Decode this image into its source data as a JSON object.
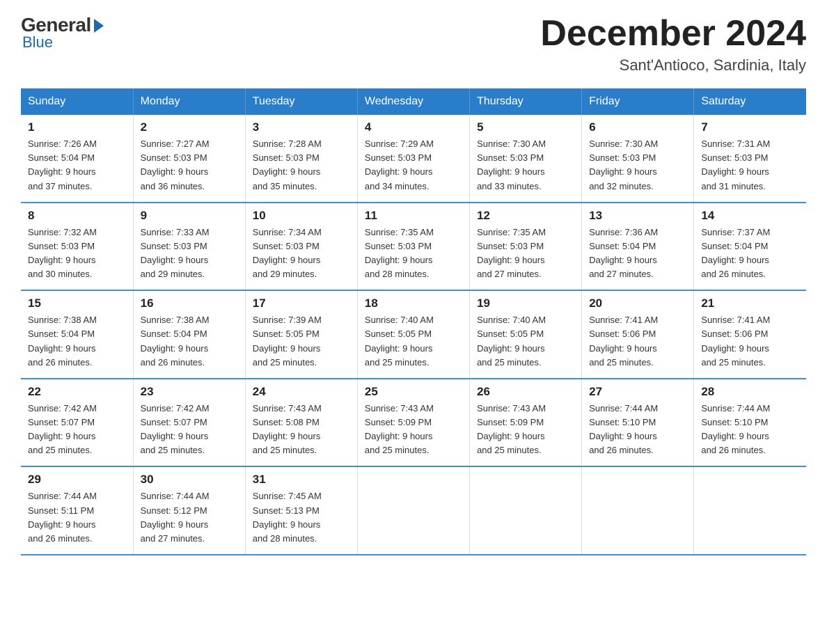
{
  "logo": {
    "general": "General",
    "blue": "Blue"
  },
  "header": {
    "month_year": "December 2024",
    "location": "Sant'Antioco, Sardinia, Italy"
  },
  "days_of_week": [
    "Sunday",
    "Monday",
    "Tuesday",
    "Wednesday",
    "Thursday",
    "Friday",
    "Saturday"
  ],
  "weeks": [
    [
      {
        "day": "1",
        "sunrise": "7:26 AM",
        "sunset": "5:04 PM",
        "daylight": "9 hours and 37 minutes."
      },
      {
        "day": "2",
        "sunrise": "7:27 AM",
        "sunset": "5:03 PM",
        "daylight": "9 hours and 36 minutes."
      },
      {
        "day": "3",
        "sunrise": "7:28 AM",
        "sunset": "5:03 PM",
        "daylight": "9 hours and 35 minutes."
      },
      {
        "day": "4",
        "sunrise": "7:29 AM",
        "sunset": "5:03 PM",
        "daylight": "9 hours and 34 minutes."
      },
      {
        "day": "5",
        "sunrise": "7:30 AM",
        "sunset": "5:03 PM",
        "daylight": "9 hours and 33 minutes."
      },
      {
        "day": "6",
        "sunrise": "7:30 AM",
        "sunset": "5:03 PM",
        "daylight": "9 hours and 32 minutes."
      },
      {
        "day": "7",
        "sunrise": "7:31 AM",
        "sunset": "5:03 PM",
        "daylight": "9 hours and 31 minutes."
      }
    ],
    [
      {
        "day": "8",
        "sunrise": "7:32 AM",
        "sunset": "5:03 PM",
        "daylight": "9 hours and 30 minutes."
      },
      {
        "day": "9",
        "sunrise": "7:33 AM",
        "sunset": "5:03 PM",
        "daylight": "9 hours and 29 minutes."
      },
      {
        "day": "10",
        "sunrise": "7:34 AM",
        "sunset": "5:03 PM",
        "daylight": "9 hours and 29 minutes."
      },
      {
        "day": "11",
        "sunrise": "7:35 AM",
        "sunset": "5:03 PM",
        "daylight": "9 hours and 28 minutes."
      },
      {
        "day": "12",
        "sunrise": "7:35 AM",
        "sunset": "5:03 PM",
        "daylight": "9 hours and 27 minutes."
      },
      {
        "day": "13",
        "sunrise": "7:36 AM",
        "sunset": "5:04 PM",
        "daylight": "9 hours and 27 minutes."
      },
      {
        "day": "14",
        "sunrise": "7:37 AM",
        "sunset": "5:04 PM",
        "daylight": "9 hours and 26 minutes."
      }
    ],
    [
      {
        "day": "15",
        "sunrise": "7:38 AM",
        "sunset": "5:04 PM",
        "daylight": "9 hours and 26 minutes."
      },
      {
        "day": "16",
        "sunrise": "7:38 AM",
        "sunset": "5:04 PM",
        "daylight": "9 hours and 26 minutes."
      },
      {
        "day": "17",
        "sunrise": "7:39 AM",
        "sunset": "5:05 PM",
        "daylight": "9 hours and 25 minutes."
      },
      {
        "day": "18",
        "sunrise": "7:40 AM",
        "sunset": "5:05 PM",
        "daylight": "9 hours and 25 minutes."
      },
      {
        "day": "19",
        "sunrise": "7:40 AM",
        "sunset": "5:05 PM",
        "daylight": "9 hours and 25 minutes."
      },
      {
        "day": "20",
        "sunrise": "7:41 AM",
        "sunset": "5:06 PM",
        "daylight": "9 hours and 25 minutes."
      },
      {
        "day": "21",
        "sunrise": "7:41 AM",
        "sunset": "5:06 PM",
        "daylight": "9 hours and 25 minutes."
      }
    ],
    [
      {
        "day": "22",
        "sunrise": "7:42 AM",
        "sunset": "5:07 PM",
        "daylight": "9 hours and 25 minutes."
      },
      {
        "day": "23",
        "sunrise": "7:42 AM",
        "sunset": "5:07 PM",
        "daylight": "9 hours and 25 minutes."
      },
      {
        "day": "24",
        "sunrise": "7:43 AM",
        "sunset": "5:08 PM",
        "daylight": "9 hours and 25 minutes."
      },
      {
        "day": "25",
        "sunrise": "7:43 AM",
        "sunset": "5:09 PM",
        "daylight": "9 hours and 25 minutes."
      },
      {
        "day": "26",
        "sunrise": "7:43 AM",
        "sunset": "5:09 PM",
        "daylight": "9 hours and 25 minutes."
      },
      {
        "day": "27",
        "sunrise": "7:44 AM",
        "sunset": "5:10 PM",
        "daylight": "9 hours and 26 minutes."
      },
      {
        "day": "28",
        "sunrise": "7:44 AM",
        "sunset": "5:10 PM",
        "daylight": "9 hours and 26 minutes."
      }
    ],
    [
      {
        "day": "29",
        "sunrise": "7:44 AM",
        "sunset": "5:11 PM",
        "daylight": "9 hours and 26 minutes."
      },
      {
        "day": "30",
        "sunrise": "7:44 AM",
        "sunset": "5:12 PM",
        "daylight": "9 hours and 27 minutes."
      },
      {
        "day": "31",
        "sunrise": "7:45 AM",
        "sunset": "5:13 PM",
        "daylight": "9 hours and 28 minutes."
      },
      null,
      null,
      null,
      null
    ]
  ]
}
